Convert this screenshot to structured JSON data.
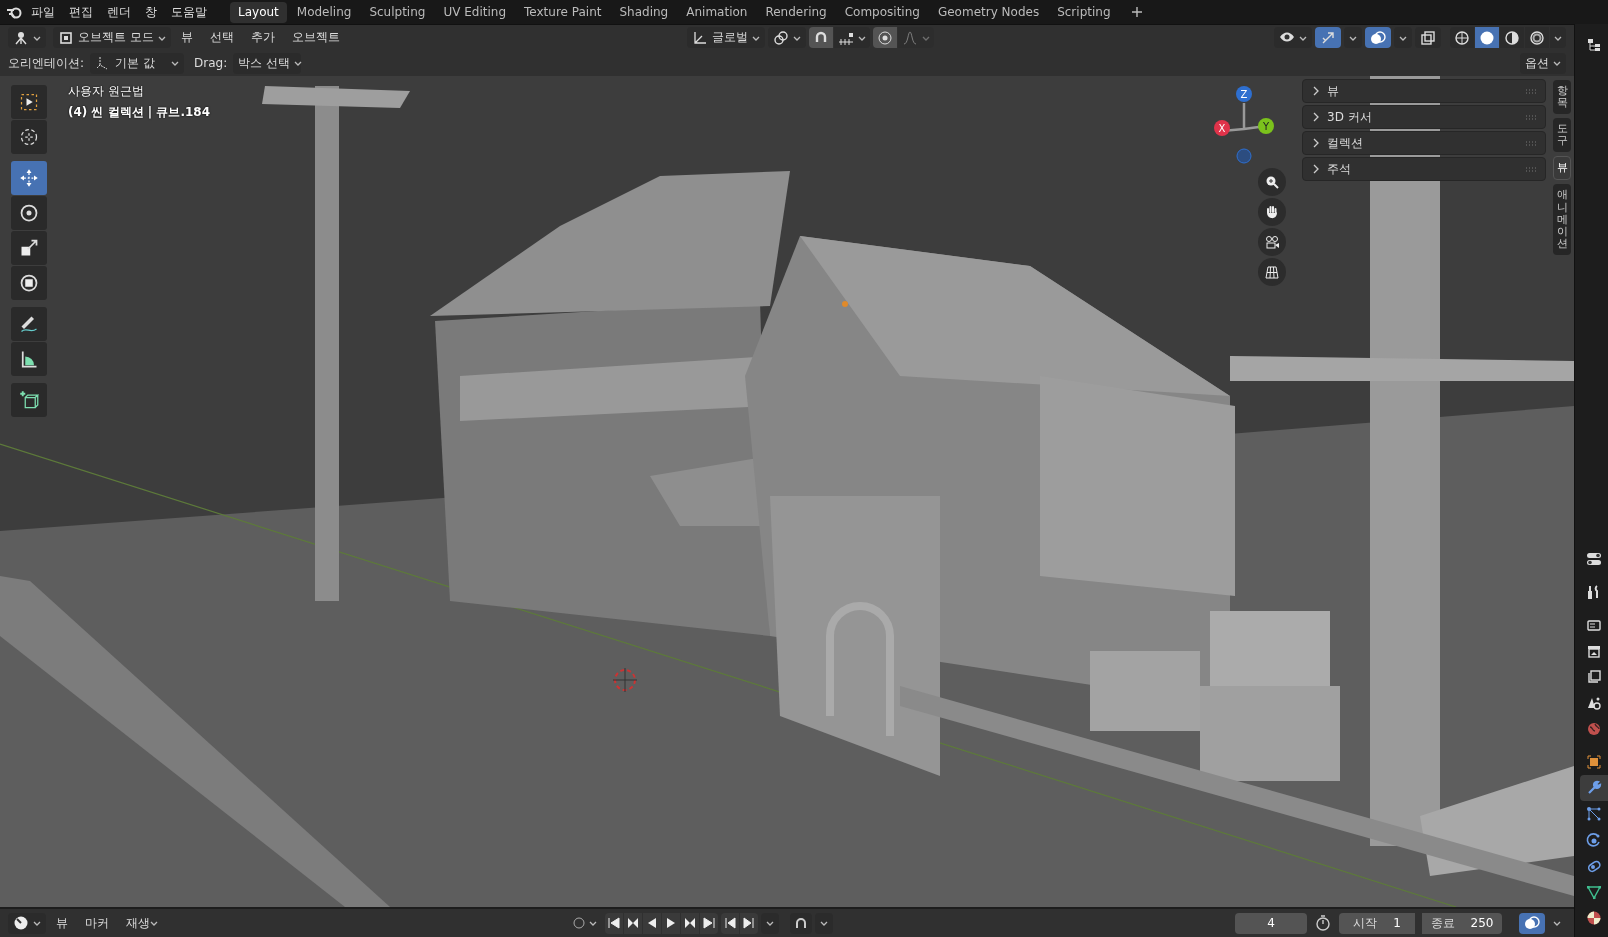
{
  "menubar": {
    "menus": [
      "파일",
      "편집",
      "렌더",
      "창",
      "도움말"
    ]
  },
  "workspaces": [
    {
      "label": "Layout",
      "selected": true
    },
    {
      "label": "Modeling",
      "selected": false
    },
    {
      "label": "Sculpting",
      "selected": false
    },
    {
      "label": "UV Editing",
      "selected": false
    },
    {
      "label": "Texture Paint",
      "selected": false
    },
    {
      "label": "Shading",
      "selected": false
    },
    {
      "label": "Animation",
      "selected": false
    },
    {
      "label": "Rendering",
      "selected": false
    },
    {
      "label": "Compositing",
      "selected": false
    },
    {
      "label": "Geometry Nodes",
      "selected": false
    },
    {
      "label": "Scripting",
      "selected": false
    }
  ],
  "viewport_header": {
    "mode": "오브젝트 모드",
    "menus": [
      "뷰",
      "선택",
      "추가",
      "오브젝트"
    ],
    "orientation": "글로벌",
    "toggles": [
      {
        "kind": "gizmo",
        "on": true
      },
      {
        "kind": "overlay",
        "on": true
      },
      {
        "kind": "xray",
        "on": false
      }
    ],
    "shading_modes": [
      {
        "kind": "wireframe",
        "selected": false
      },
      {
        "kind": "solid",
        "selected": true
      },
      {
        "kind": "material",
        "selected": false
      },
      {
        "kind": "rendered",
        "selected": false
      }
    ]
  },
  "tool_settings": {
    "orientation_label": "오리엔테이션:",
    "orientation": "기본 값",
    "drag_label": "Drag:",
    "drag": "박스 선택",
    "options": "옵션"
  },
  "toolbar": [
    {
      "kind": "select_box",
      "selected": false
    },
    {
      "kind": "cursor",
      "selected": false
    },
    {
      "kind": "move",
      "selected": true
    },
    {
      "kind": "rotate",
      "selected": false
    },
    {
      "kind": "scale",
      "selected": false
    },
    {
      "kind": "transform",
      "selected": false
    },
    {
      "kind": "annotate",
      "selected": false
    },
    {
      "kind": "measure",
      "selected": false
    },
    {
      "kind": "add_cube",
      "selected": false
    }
  ],
  "viewport_info": {
    "view": "사용자 원근법",
    "object": "(4) 씬 컬렉션 | 큐브.184"
  },
  "navigation_gizmo": {
    "z": "Z",
    "x": "X",
    "y": "Y"
  },
  "sidebar": {
    "panels": [
      {
        "label": "뷰",
        "expanded": false
      },
      {
        "label": "3D 커서",
        "expanded": false
      },
      {
        "label": "컬렉션",
        "expanded": false
      },
      {
        "label": "주석",
        "expanded": false
      }
    ],
    "tabs": [
      {
        "label": "항목",
        "selected": false
      },
      {
        "label": "도구",
        "selected": false
      },
      {
        "label": "뷰",
        "selected": true
      },
      {
        "label": "애니메이션",
        "selected": false
      }
    ]
  },
  "properties_tabs": [
    {
      "kind": "tool",
      "selected": false
    },
    {
      "kind": "render",
      "selected": false
    },
    {
      "kind": "output",
      "selected": false
    },
    {
      "kind": "view_layer",
      "selected": false
    },
    {
      "kind": "scene",
      "selected": false
    },
    {
      "kind": "world",
      "selected": false
    },
    {
      "kind": "object",
      "selected": false
    },
    {
      "kind": "modifiers",
      "selected": true
    },
    {
      "kind": "particles",
      "selected": false
    },
    {
      "kind": "physics",
      "selected": false
    },
    {
      "kind": "constraints",
      "selected": false
    },
    {
      "kind": "data",
      "selected": false
    },
    {
      "kind": "material",
      "selected": false
    }
  ],
  "timeline": {
    "menus": [
      "뷰",
      "마커",
      "재생"
    ],
    "current_frame": "4",
    "start_label": "시작",
    "start": "1",
    "end_label": "종료",
    "end": "250"
  }
}
